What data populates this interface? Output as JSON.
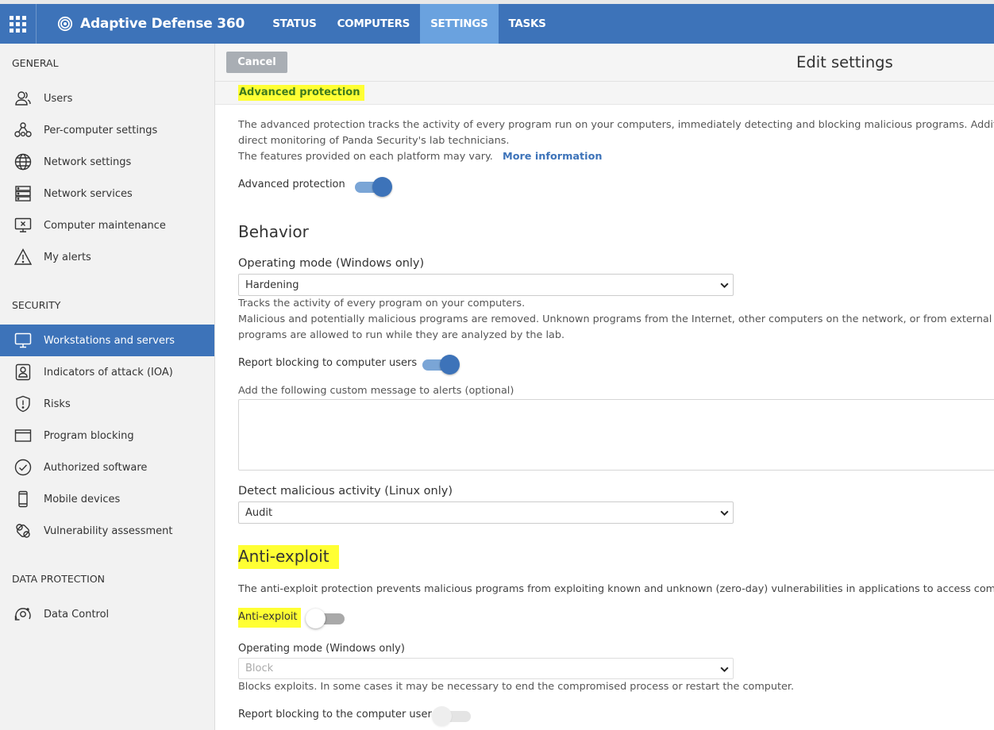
{
  "app": {
    "brand": "Adaptive Defense 360",
    "nav": [
      {
        "label": "STATUS",
        "active": false
      },
      {
        "label": "COMPUTERS",
        "active": false
      },
      {
        "label": "SETTINGS",
        "active": true
      },
      {
        "label": "TASKS",
        "active": false
      }
    ],
    "accent_color": "#3d73b9"
  },
  "sidebar": {
    "sections": [
      "GENERAL",
      "SECURITY",
      "DATA PROTECTION"
    ],
    "items": [
      {
        "label": "Users",
        "icon": "users-icon"
      },
      {
        "label": "Per-computer settings",
        "icon": "per-computer-settings-icon"
      },
      {
        "label": "Network settings",
        "icon": "globe-icon"
      },
      {
        "label": "Network services",
        "icon": "server-stack-icon"
      },
      {
        "label": "Computer maintenance",
        "icon": "computer-maintenance-icon"
      },
      {
        "label": "My alerts",
        "icon": "warning-icon"
      },
      {
        "label": "Workstations and servers",
        "icon": "monitor-icon",
        "active": true
      },
      {
        "label": "Indicators of attack (IOA)",
        "icon": "ioa-badge-icon"
      },
      {
        "label": "Risks",
        "icon": "shield-alert-icon"
      },
      {
        "label": "Program blocking",
        "icon": "window-icon"
      },
      {
        "label": "Authorized software",
        "icon": "check-circle-icon"
      },
      {
        "label": "Mobile devices",
        "icon": "mobile-icon"
      },
      {
        "label": "Vulnerability assessment",
        "icon": "vulnerability-icon"
      },
      {
        "label": "Data Control",
        "icon": "data-control-icon"
      }
    ]
  },
  "header": {
    "cancel_label": "Cancel",
    "title": "Edit settings"
  },
  "advanced": {
    "band_title": "Advanced protection",
    "desc_line1": "The advanced protection tracks the activity of every program run on your computers, immediately detecting and blocking malicious programs. Additionally,",
    "desc_line2": "direct monitoring of Panda Security's lab technicians.",
    "desc_line3": "The features provided on each platform may vary.",
    "more_info": "More information",
    "toggle_label": "Advanced protection",
    "toggle_on": true
  },
  "behavior": {
    "heading": "Behavior",
    "mode_label": "Operating mode (Windows only)",
    "mode_value": "Hardening",
    "mode_desc1": "Tracks the activity of every program on your computers.",
    "mode_desc2": "Malicious and potentially malicious programs are removed. Unknown programs from the Internet, other computers on the network, or from external storag",
    "mode_desc3": "programs are allowed to run while they are analyzed by the lab.",
    "report_label": "Report blocking to computer users",
    "report_on": true,
    "custom_msg_label": "Add the following custom message to alerts (optional)",
    "custom_msg_value": "",
    "linux_label": "Detect malicious activity (Linux only)",
    "linux_value": "Audit"
  },
  "antiexploit": {
    "heading": "Anti-exploit",
    "desc": "The anti-exploit protection prevents malicious programs from exploiting known and unknown (zero-day) vulnerabilities in applications to access computers o",
    "toggle_label": "Anti-exploit",
    "toggle_on": false,
    "mode_label": "Operating mode (Windows only)",
    "mode_value": "Block",
    "mode_desc": "Blocks exploits. In some cases it may be necessary to end the compromised process or restart the computer.",
    "report_label": "Report blocking to the computer user",
    "report_on": false
  }
}
